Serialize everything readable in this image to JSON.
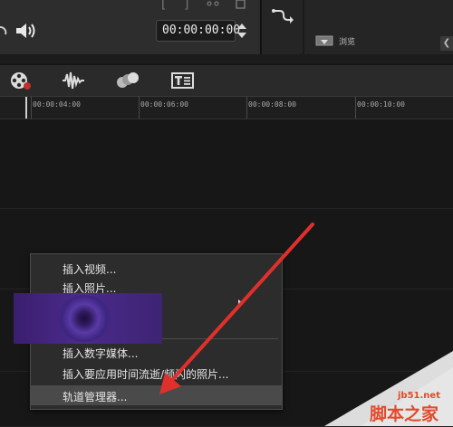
{
  "preview": {
    "timecode": "00:00:00:00",
    "browse_label": "浏览"
  },
  "toolbar": {
    "icons": [
      "film-reel-icon",
      "audio-waveform-icon",
      "circles-icon",
      "title-icon"
    ]
  },
  "ruler": {
    "ticks": [
      "00:00:04:00",
      "00:00:06:00",
      "00:00:08:00",
      "00:00:10:00"
    ]
  },
  "context_menu": {
    "items": [
      {
        "label": "插入视频..."
      },
      {
        "label": "插入照片..."
      },
      {
        "label": "插入数字媒体..."
      },
      {
        "label": "插入要应用时间流逝/频闪的照片..."
      },
      {
        "label": "轨道管理器..."
      }
    ]
  },
  "watermark": {
    "site": "jb51.net",
    "name": "脚本之家"
  },
  "colors": {
    "arrow": "#e0302c",
    "menu_bg": "#2c2c2c",
    "thumbnail": "#4b2a8c"
  }
}
